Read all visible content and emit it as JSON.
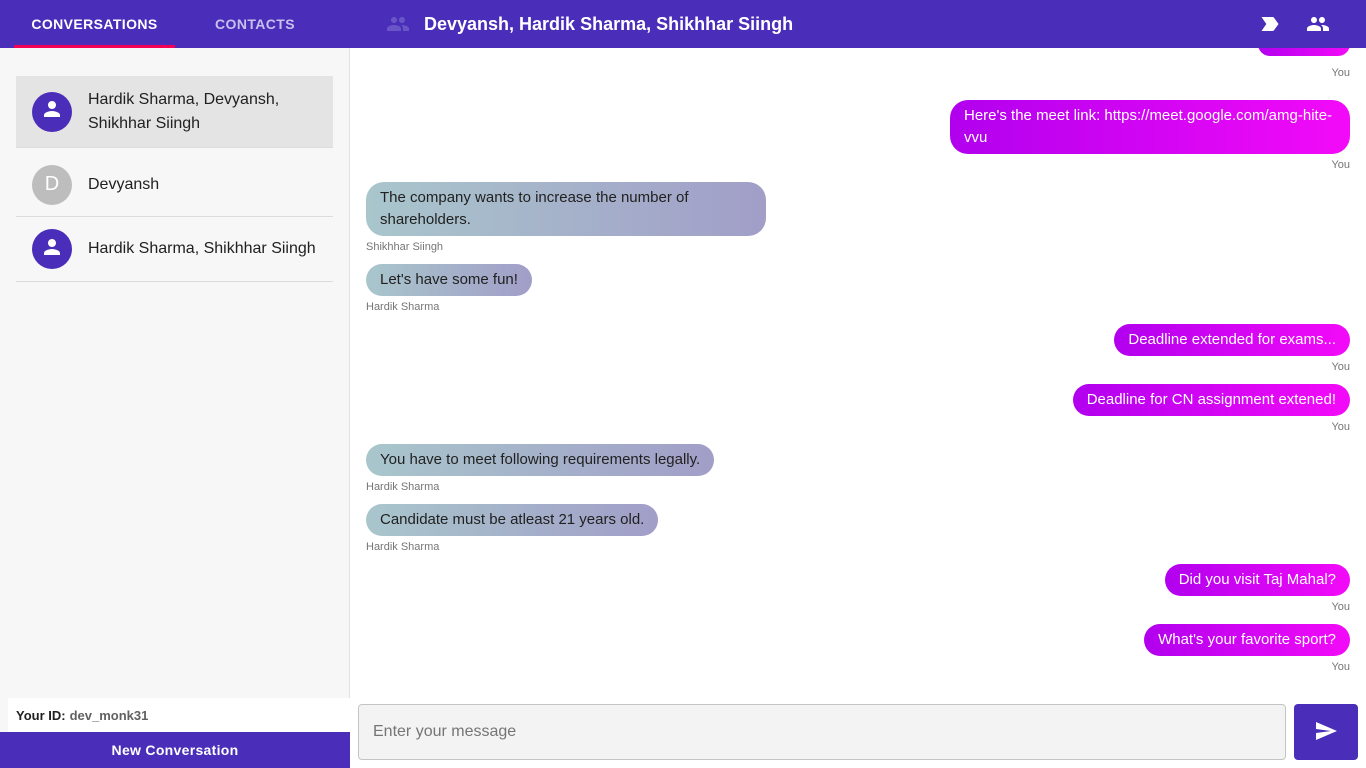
{
  "tabs": {
    "conversations": "CONVERSATIONS",
    "contacts": "CONTACTS"
  },
  "header": {
    "title": "Devyansh, Hardik Sharma, Shikhhar Siingh"
  },
  "conversations": [
    {
      "name": "Hardik Sharma, Devyansh, Shikhhar Siingh",
      "avatar": "person-icon",
      "active": true
    },
    {
      "name": "Devyansh",
      "avatar_letter": "D"
    },
    {
      "name": "Hardik Sharma, Shikhhar Siingh",
      "avatar": "person-icon"
    }
  ],
  "user": {
    "id_label": "Your ID:",
    "id_value": "dev_monk31"
  },
  "new_conversation_label": "New Conversation",
  "messages": [
    {
      "sender": "You",
      "text": "Here's the meet link: https://meet.google.com/amg-hite-vvu"
    },
    {
      "sender": "Shikhhar Siingh",
      "text": "The company wants to increase the number of shareholders."
    },
    {
      "sender": "Hardik Sharma",
      "text": "Let's have some fun!"
    },
    {
      "sender": "You",
      "text": "Deadline extended for exams..."
    },
    {
      "sender": "You",
      "text": "Deadline for CN assignment extened!"
    },
    {
      "sender": "Hardik Sharma",
      "text": "You have to meet following requirements legally."
    },
    {
      "sender": "Hardik Sharma",
      "text": "Candidate must be atleast 21 years old."
    },
    {
      "sender": "You",
      "text": "Did you visit Taj Mahal?"
    },
    {
      "sender": "You",
      "text": "What's your favorite sport?"
    }
  ],
  "top_partial_sender": "You",
  "composer": {
    "placeholder": "Enter your message"
  },
  "colors": {
    "primary": "#4a2db8",
    "accent": "#f50057",
    "my_bubble_start": "#b100ee",
    "my_bubble_end": "#f30af8",
    "their_bubble_start": "#a9c6cc",
    "their_bubble_end": "#a19ec8"
  },
  "icons": {
    "header_group": "group-icon",
    "tag": "label-icon",
    "people": "people-icon",
    "send": "send-icon"
  }
}
